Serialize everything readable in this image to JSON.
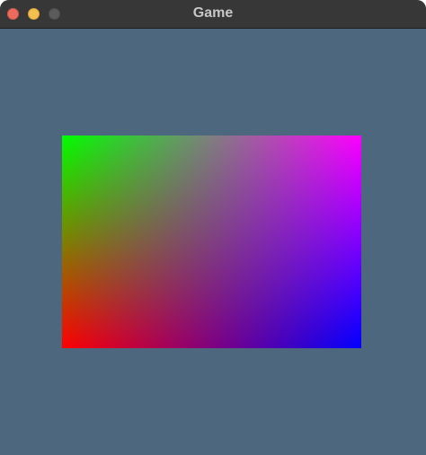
{
  "window": {
    "title": "Game",
    "controls": {
      "close": "close-button",
      "minimize": "minimize-button",
      "zoom": "zoom-button"
    }
  },
  "colors": {
    "background": "#4d677f",
    "titlebar": "#373737",
    "quad_corners": {
      "top_left": "#00ff00",
      "top_right": "#ff00ff",
      "bottom_left": "#ff0000",
      "bottom_right": "#0000ff"
    }
  }
}
